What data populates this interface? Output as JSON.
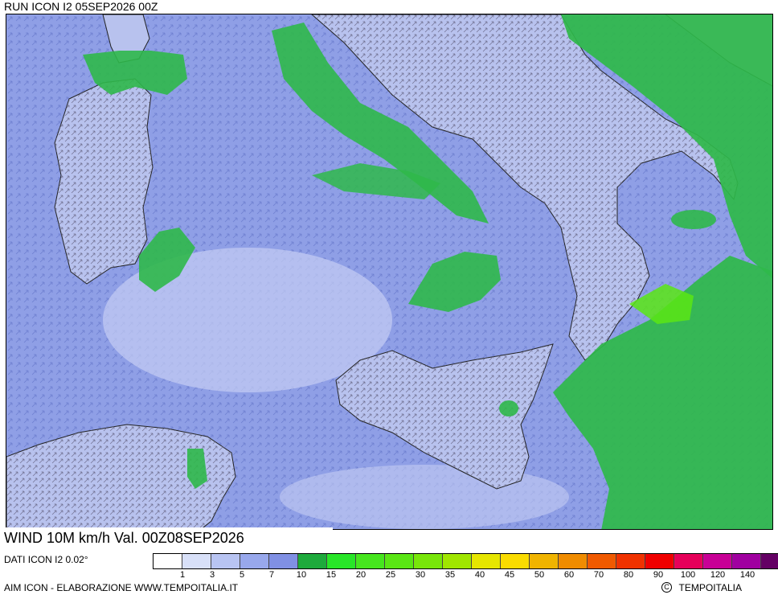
{
  "header": {
    "run_title": "RUN ICON I2 05SEP2026 00Z",
    "wind_title": "WIND 10M km/h Val. 00Z08SEP2026",
    "source_label": "DATI ICON I2 0.02°"
  },
  "footer": {
    "left_text": "AIM ICON - ELABORAZIONE WWW.TEMPOITALIA.IT",
    "copyright_symbol": "C",
    "right_text": "TEMPOITALIA"
  },
  "legend": {
    "unit": "km/h",
    "colors": [
      "#ffffff",
      "#d8e0f8",
      "#b8c4f2",
      "#98a8ec",
      "#8090e4",
      "#1eaa3c",
      "#28e628",
      "#46e61e",
      "#5ae614",
      "#78e60a",
      "#a0e600",
      "#e6e600",
      "#fadc00",
      "#f0b400",
      "#f08c00",
      "#f05a00",
      "#f03200",
      "#f00000",
      "#e6005a",
      "#c80096",
      "#a000a0",
      "#640064"
    ],
    "labels": [
      "1",
      "3",
      "5",
      "7",
      "10",
      "15",
      "20",
      "25",
      "30",
      "35",
      "40",
      "45",
      "50",
      "60",
      "70",
      "80",
      "90",
      "100",
      "120",
      "140"
    ]
  },
  "map": {
    "land_fill": "#b8c2ee",
    "sea_fill": "#8f9fe6",
    "strong_wind_fill": "#2fb84a",
    "coast_color": "#222222"
  }
}
